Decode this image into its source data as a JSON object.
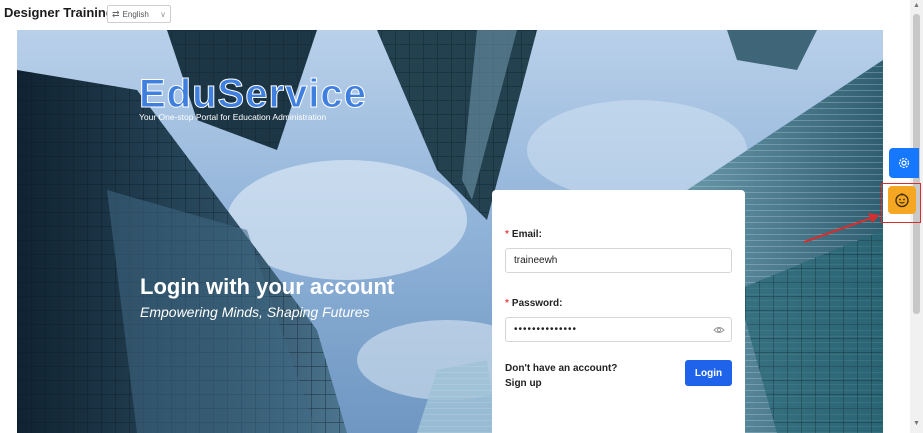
{
  "header": {
    "title": "Designer Training",
    "language": {
      "icon": "translate-icon",
      "selected": "English"
    }
  },
  "hero": {
    "brand_name": "EduService",
    "brand_tagline": "Your One-stop Portal for Education Administration",
    "heading": "Login with your account",
    "subheading": "Empowering Minds, Shaping Futures"
  },
  "login": {
    "email_label": "Email:",
    "email_value": "traineewh",
    "password_label": "Password:",
    "password_value": "••••••••••••••",
    "signup_text": "Don't have an account? Sign up",
    "login_button": "Login",
    "required_mark": "*"
  },
  "floating": {
    "settings_icon": "gear-icon",
    "assistant_icon": "smiley-icon"
  },
  "colors": {
    "primary": "#1e63e9",
    "brand_blue": "#3f7fe0",
    "settings_blue": "#1677ff",
    "assistant_orange": "#f5a623",
    "annotation_red": "#d32f2f",
    "required_red": "#e5484d"
  }
}
